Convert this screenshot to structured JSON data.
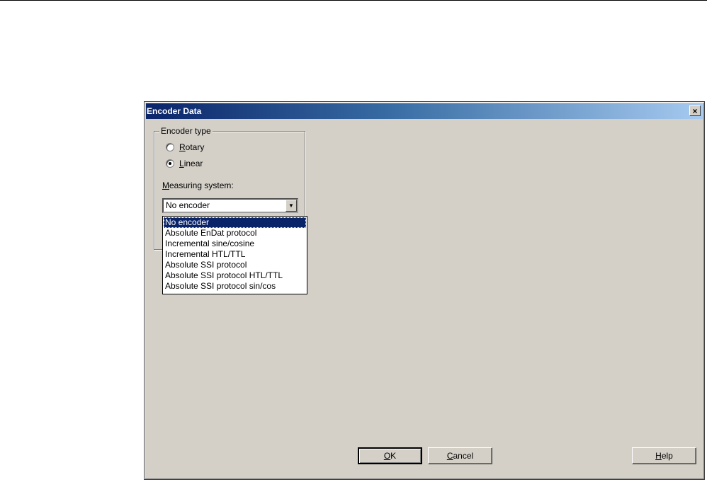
{
  "dialog": {
    "title": "Encoder Data",
    "close_glyph": "×",
    "close_icon": "close-icon"
  },
  "encoder_type": {
    "label": "Encoder type",
    "options": [
      {
        "prefix": "",
        "accel": "R",
        "rest": "otary",
        "checked": false
      },
      {
        "prefix": "",
        "accel": "L",
        "rest": "inear",
        "checked": true
      }
    ]
  },
  "measuring_system": {
    "label_accel": "M",
    "label_rest": "easuring system:",
    "value": "No encoder",
    "arrow_glyph": "▼",
    "arrow_icon": "chevron-down-icon",
    "options": [
      "No encoder",
      "Absolute EnDat protocol",
      "Incremental sine/cosine",
      "Incremental HTL/TTL",
      "Absolute SSI protocol",
      "Absolute SSI protocol HTL/TTL",
      "Absolute SSI protocol sin/cos"
    ],
    "selected_index": 0
  },
  "buttons": {
    "ok": {
      "accel": "O",
      "rest": "K"
    },
    "cancel": {
      "accel": "C",
      "rest": "ancel"
    },
    "help": {
      "accel": "H",
      "rest": "elp"
    }
  },
  "colors": {
    "face": "#d4d0c8",
    "title_start": "#0a246a",
    "title_end": "#a6caf0",
    "selection": "#0a246a"
  }
}
